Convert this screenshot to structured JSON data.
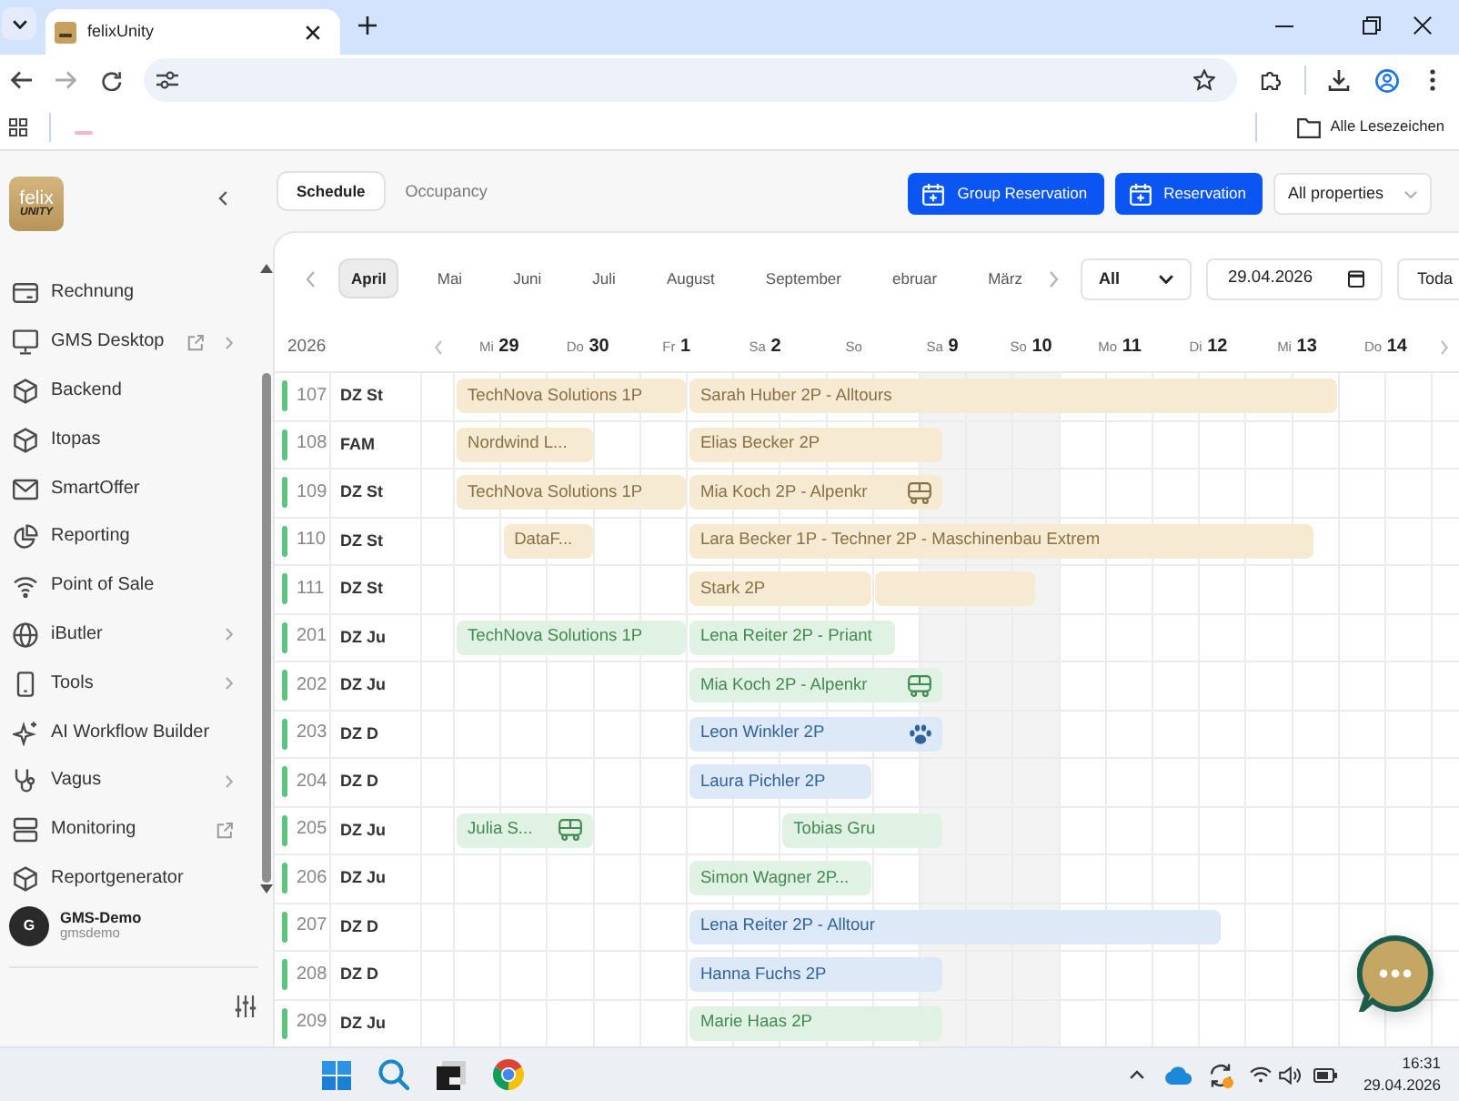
{
  "browser": {
    "tab_title": "felixUnity",
    "bookmarks_folder": "Alle Lesezeichen"
  },
  "sidebar": {
    "logo": {
      "line_1": "felix",
      "line_2": "UNITY"
    },
    "items": [
      {
        "label": "Rechnung",
        "external": false,
        "submenu": false
      },
      {
        "label": "GMS Desktop",
        "external": true,
        "submenu": true
      },
      {
        "label": "Backend",
        "external": false,
        "submenu": false
      },
      {
        "label": "Itopas",
        "external": false,
        "submenu": false
      },
      {
        "label": "SmartOffer",
        "external": false,
        "submenu": false
      },
      {
        "label": "Reporting",
        "external": false,
        "submenu": false
      },
      {
        "label": "Point of Sale",
        "external": false,
        "submenu": false
      },
      {
        "label": "iButler",
        "external": false,
        "submenu": true
      },
      {
        "label": "Tools",
        "external": false,
        "submenu": true
      },
      {
        "label": "AI Workflow Builder",
        "external": false,
        "submenu": false
      },
      {
        "label": "Vagus",
        "external": false,
        "submenu": true
      },
      {
        "label": "Monitoring",
        "external": true,
        "submenu": false
      },
      {
        "label": "Reportgenerator",
        "external": false,
        "submenu": false
      }
    ],
    "user": {
      "initial": "G",
      "name": "GMS-Demo",
      "username": "gmsdemo"
    }
  },
  "view_tabs": [
    {
      "label": "Schedule",
      "selected": true
    },
    {
      "label": "Occupancy",
      "selected": false
    }
  ],
  "actions": [
    {
      "label": "Group Reservation"
    },
    {
      "label": "Reservation"
    }
  ],
  "property_select": {
    "value": "All properties"
  },
  "months": [
    {
      "label": "April",
      "selected": true
    },
    {
      "label": "Mai",
      "selected": false
    },
    {
      "label": "Juni",
      "selected": false
    },
    {
      "label": "Juli",
      "selected": false
    },
    {
      "label": "August",
      "selected": false
    },
    {
      "label": "September",
      "selected": false
    },
    {
      "label": "ebruar",
      "selected": false
    },
    {
      "label": "März",
      "selected": false
    }
  ],
  "filter_select": {
    "value": "All"
  },
  "date_field": {
    "value": "29.04.2026"
  },
  "today_button": {
    "label": "Toda"
  },
  "timeline": {
    "year": "2026",
    "days": [
      {
        "weekday": "Mi",
        "day": "29"
      },
      {
        "weekday": "Do",
        "day": "30"
      },
      {
        "weekday": "Fr",
        "day": "1"
      },
      {
        "weekday": "Sa",
        "day": "2"
      },
      {
        "weekday": "So"
      },
      {
        "weekday": "Sa",
        "day": "9"
      },
      {
        "weekday": "So",
        "day": "10"
      },
      {
        "weekday": "Mo",
        "day": "11"
      },
      {
        "weekday": "Di",
        "day": "12"
      },
      {
        "weekday": "Mi",
        "day": "13"
      },
      {
        "weekday": "Do",
        "day": "14"
      }
    ]
  },
  "rooms": [
    {
      "number": "107",
      "type": "DZ St",
      "bookings": [
        {
          "guest": "TechNova Solutions 1P",
          "color": "#f6ead3",
          "kind": "plain"
        },
        {
          "guest": "Sarah Huber 2P - Alltours",
          "color": "#f6ead3",
          "kind": "plain"
        }
      ]
    },
    {
      "number": "108",
      "type": "FAM",
      "bookings": [
        {
          "guest": "Nordwind L...",
          "color": "#f6ead3",
          "kind": "plain"
        },
        {
          "guest": "Elias Becker 2P",
          "color": "#f6ead3",
          "kind": "plain"
        }
      ]
    },
    {
      "number": "109",
      "type": "DZ St",
      "bookings": [
        {
          "guest": "TechNova Solutions 1P",
          "color": "#f6ead3",
          "kind": "plain"
        },
        {
          "guest": "Mia Koch 2P - Alpenkr",
          "color": "#f6ead3",
          "kind": "bus"
        }
      ]
    },
    {
      "number": "110",
      "type": "DZ St",
      "bookings": [
        {
          "guest": "DataF...",
          "color": "#f6ead3",
          "kind": "plain"
        },
        {
          "guest": "Lara Becker 1P - Techner 2P - Maschinenbau Extrem",
          "color": "#f6ead3",
          "kind": "plain"
        }
      ]
    },
    {
      "number": "111",
      "type": "DZ St",
      "bookings": [
        {
          "guest": "Stark 2P",
          "color": "#f6ead3",
          "kind": "plain"
        },
        {
          "color": "#f6ead3",
          "kind": "plain"
        }
      ]
    },
    {
      "number": "201",
      "type": "DZ Ju",
      "bookings": [
        {
          "guest": "TechNova Solutions 1P",
          "color": "#dff2e3",
          "kind": "plain"
        },
        {
          "guest": "Lena Reiter 2P - Priant",
          "color": "#dff2e3",
          "kind": "plain"
        }
      ]
    },
    {
      "number": "202",
      "type": "DZ Ju",
      "bookings": [
        {
          "guest": "Mia Koch 2P - Alpenkr",
          "color": "#dff2e3",
          "kind": "bus"
        }
      ]
    },
    {
      "number": "203",
      "type": "DZ D",
      "bookings": [
        {
          "guest": "Leon Winkler 2P",
          "color": "#dde9f7",
          "kind": "pet"
        }
      ]
    },
    {
      "number": "204",
      "type": "DZ D",
      "bookings": [
        {
          "guest": "Laura Pichler 2P",
          "color": "#dde9f7",
          "kind": "plain"
        }
      ]
    },
    {
      "number": "205",
      "type": "DZ Ju",
      "bookings": [
        {
          "guest": "Julia S...",
          "color": "#dff2e3",
          "kind": "bus"
        },
        {
          "guest": "Tobias Gru",
          "color": "#dff2e3",
          "kind": "plain"
        }
      ]
    },
    {
      "number": "206",
      "type": "DZ Ju",
      "bookings": [
        {
          "guest": "Simon Wagner 2P...",
          "color": "#dff2e3",
          "kind": "plain"
        }
      ]
    },
    {
      "number": "207",
      "type": "DZ D",
      "bookings": [
        {
          "guest": "Lena Reiter 2P - Alltour",
          "color": "#dde9f7",
          "kind": "plain"
        }
      ]
    },
    {
      "number": "208",
      "type": "DZ D",
      "bookings": [
        {
          "guest": "Hanna Fuchs 2P",
          "color": "#dde9f7",
          "kind": "plain"
        }
      ]
    },
    {
      "number": "209",
      "type": "DZ Ju",
      "bookings": [
        {
          "guest": "Marie Haas 2P",
          "color": "#dff2e3",
          "kind": "plain"
        }
      ]
    }
  ],
  "taskbar": {
    "time": "16:31",
    "date": "29.04.2026"
  }
}
